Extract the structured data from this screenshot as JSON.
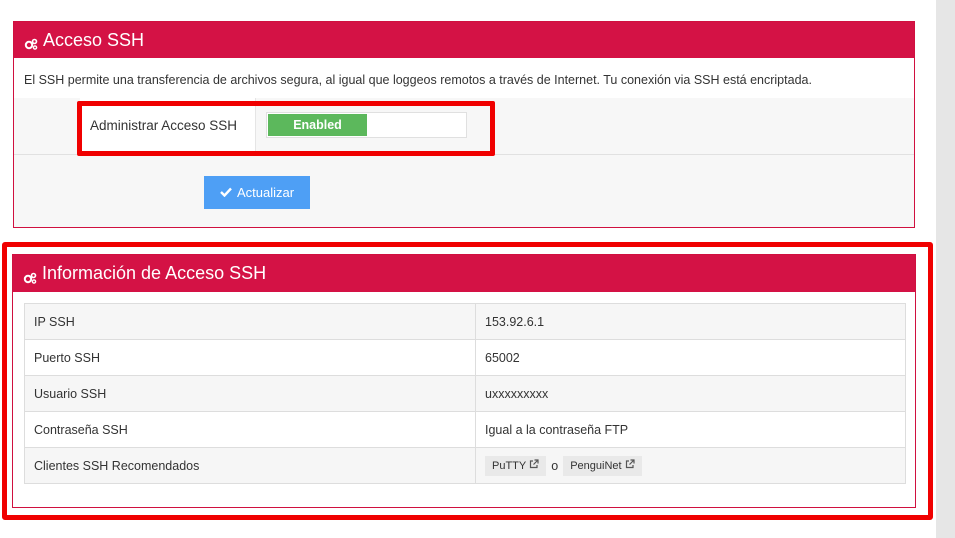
{
  "ssh_panel": {
    "title": "Acceso SSH",
    "description": "El SSH permite una transferencia de archivos segura, al igual que loggeos remotos a través de Internet. Tu conexión via SSH está encriptada.",
    "manage_label": "Administrar Acceso SSH",
    "toggle_state": "Enabled",
    "update_button": "Actualizar",
    "icon": "cogs-icon"
  },
  "info_panel": {
    "title": "Información de Acceso SSH",
    "rows": [
      {
        "label": "IP SSH",
        "value": "153.92.6.1"
      },
      {
        "label": "Puerto SSH",
        "value": "65002"
      },
      {
        "label": "Usuario SSH",
        "value": "uxxxxxxxxx"
      },
      {
        "label": "Contraseña SSH",
        "value": "Igual a la contraseña FTP"
      },
      {
        "label": "Clientes SSH Recomendados",
        "value": ""
      }
    ],
    "clients": {
      "putty": "PuTTY",
      "separator": "o",
      "penguinet": "PenguiNet"
    }
  },
  "colors": {
    "header": "#d41245",
    "toggle_on": "#5cb85c",
    "button": "#4e9ff5",
    "highlight": "#f00000"
  }
}
